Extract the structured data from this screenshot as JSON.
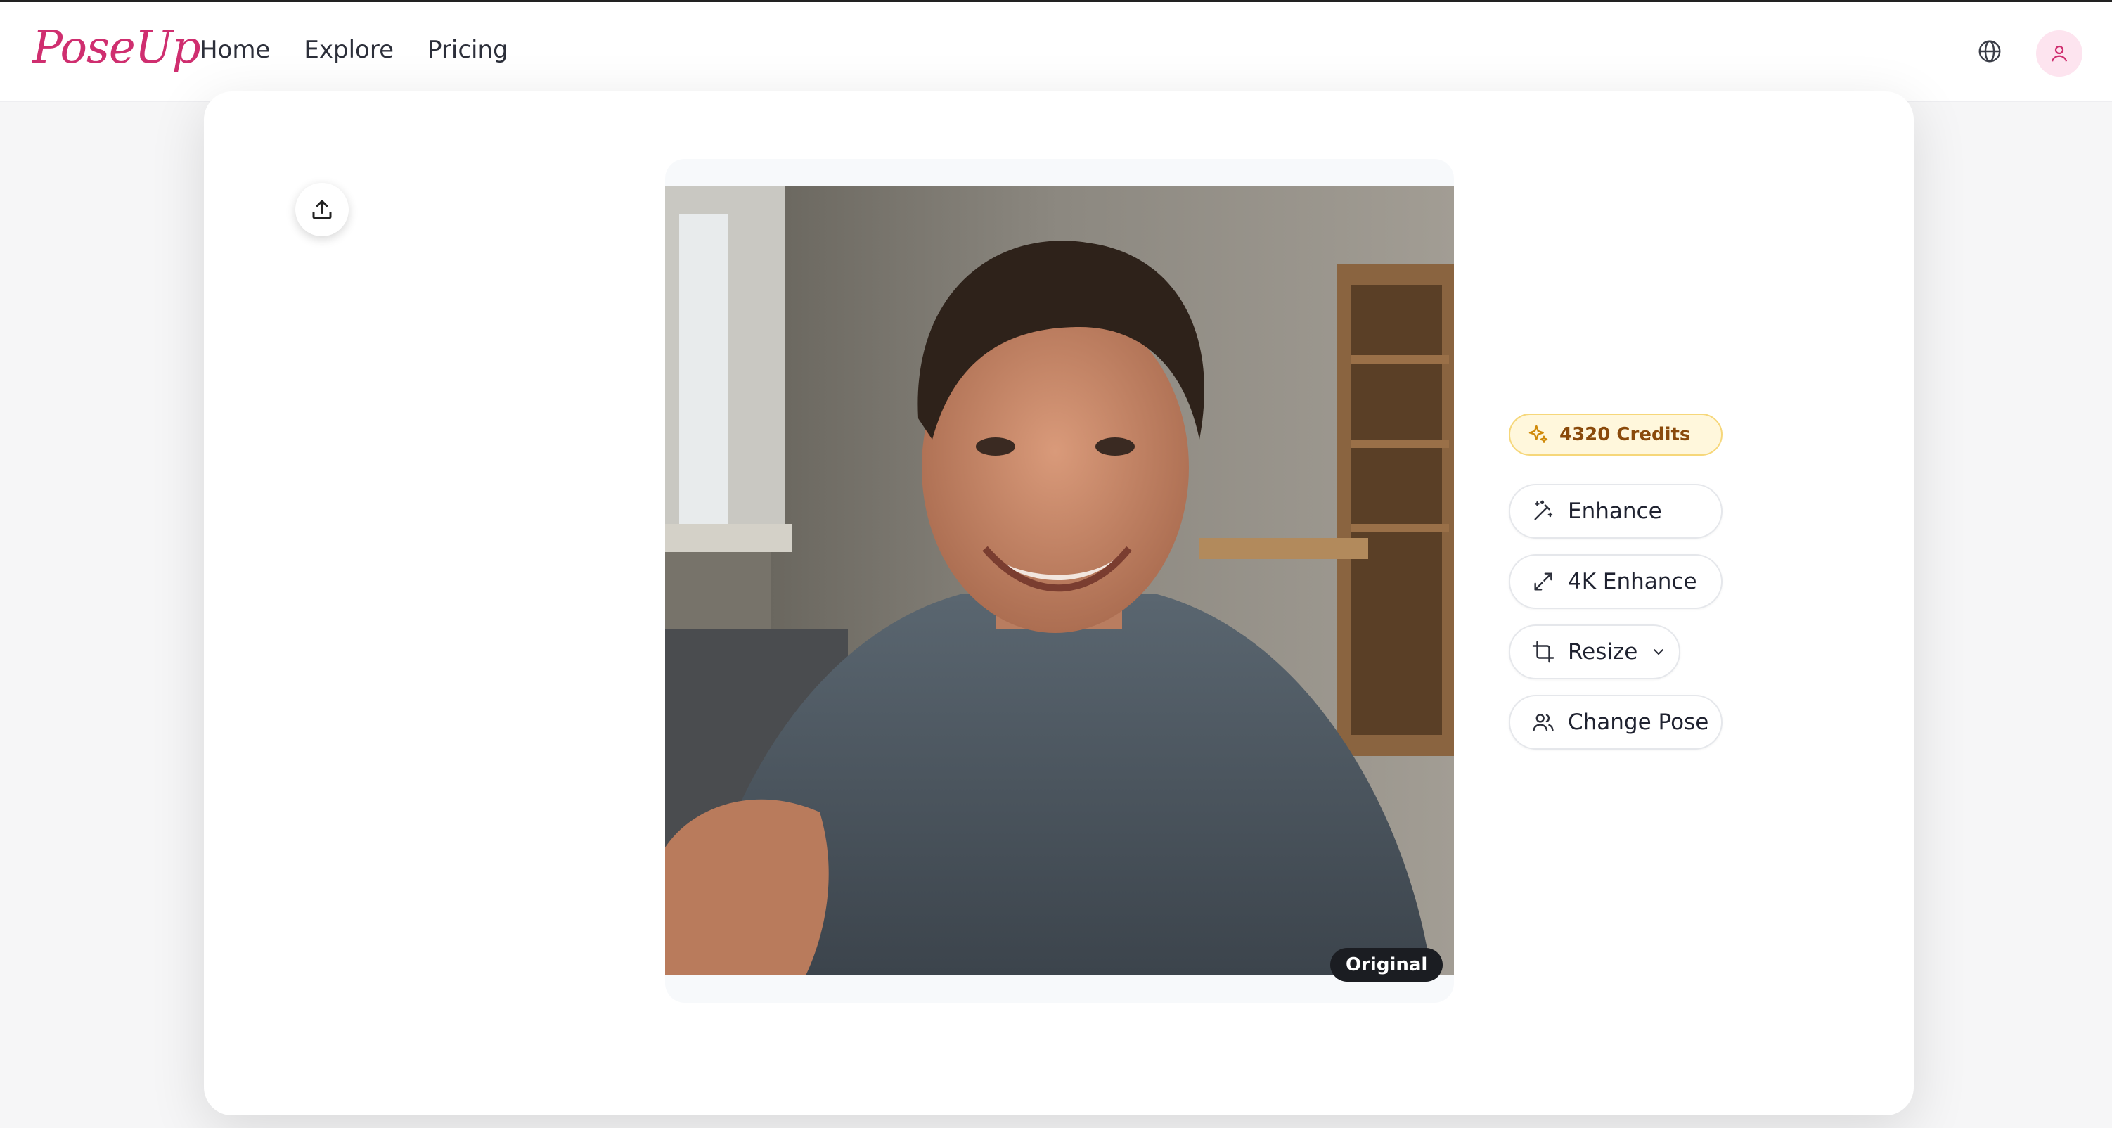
{
  "app": {
    "logo_text": "PoseUp"
  },
  "nav": {
    "items": [
      {
        "label": "Home"
      },
      {
        "label": "Explore"
      },
      {
        "label": "Pricing"
      }
    ]
  },
  "header": {
    "globe_icon": "globe-icon",
    "avatar_icon": "user-icon"
  },
  "editor": {
    "upload_icon": "upload-icon",
    "image_badge": "Original",
    "credits": {
      "label": "4320 Credits",
      "icon": "sparkles-icon"
    },
    "actions": [
      {
        "label": "Enhance",
        "icon": "magic-wand-icon"
      },
      {
        "label": "4K Enhance",
        "icon": "expand-icon"
      },
      {
        "label": "Resize",
        "icon": "crop-icon",
        "dropdown": true
      },
      {
        "label": "Change Pose",
        "icon": "users-icon"
      }
    ]
  },
  "colors": {
    "brand": "#cf2e6f",
    "credits_bg": "#fff7dc",
    "credits_text": "#8a4a0b"
  }
}
